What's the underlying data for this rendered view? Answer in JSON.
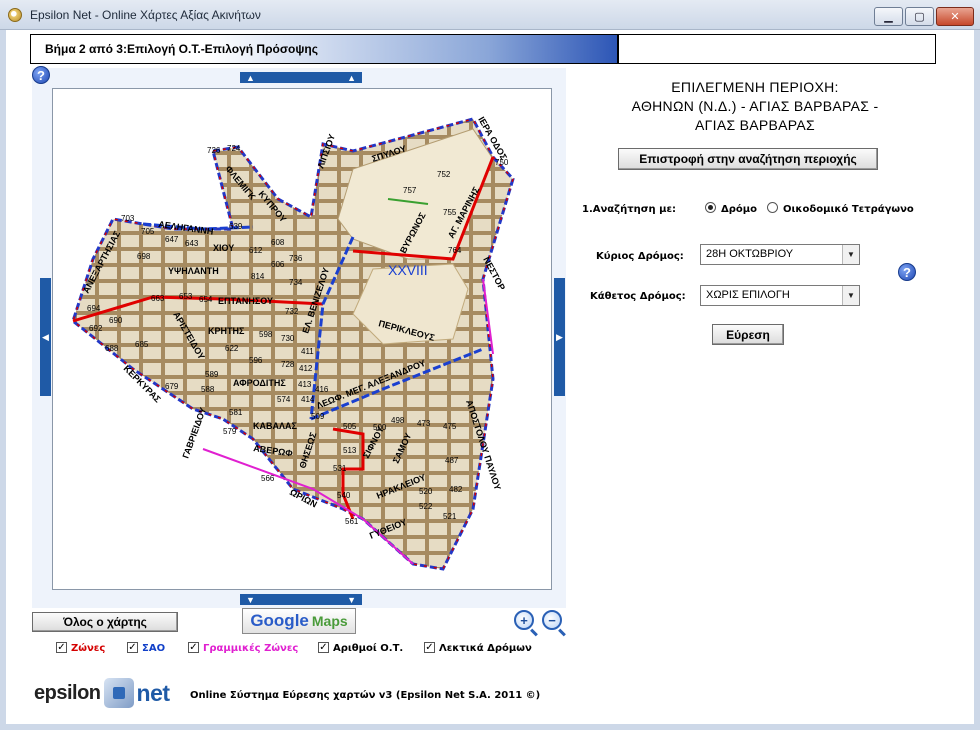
{
  "window": {
    "title": "Epsilon Net - Online Χάρτες Αξίας Ακινήτων",
    "minimize_glyph": "▁",
    "maximize_glyph": "▢",
    "close_glyph": "✕"
  },
  "header": {
    "step_label": "Βήμα 2 από 3:Επιλογή Ο.Τ.-Επιλογή Πρόσοψης"
  },
  "help_glyph": "?",
  "pan_glyph_up": "▲",
  "pan_glyph_down": "▼",
  "pan_glyph_left": "◀",
  "pan_glyph_right": "▶",
  "map": {
    "zone_label": "XXVIII",
    "streets": [
      "ΙΕΡΑ ΟΔΟΣ",
      "ΣΠΥΛΟΥ",
      "ΛΙΠΣΙΟΥ",
      "ΦΛΕΜΙΓΚ",
      "ΚΥΠΡΟΥ",
      "ΑΕΛΗΓΑΝΝΗ",
      "ΑΝΕΞΑΡΤΗΣΙΑΣ",
      "ΧΙΟΥ",
      "ΥΨΗΛΑΝΤΗ",
      "ΕΠΤΑΝΗΣΟΥ",
      "ΚΡΗΤΗΣ",
      "ΕΛ. ΒΕΝΙΖΕΛΟΥ",
      "ΒΥΡΩΝΟΣ",
      "ΑΓ. ΜΑΡΙΝΗΣ",
      "ΝΕΣΤΟΡ",
      "ΠΕΡΙΚΛΕΟΥΣ",
      "ΛΕΩΦ. ΜΕΓ. ΑΛΕΞΑΝΔΡΟΥ",
      "ΑΡΙΣΤΕΙΔΟΥ",
      "ΚΕΡΚΥΡΑΣ",
      "ΑΦΡΟΔΙΤΗΣ",
      "ΚΑΒΑΛΑΣ",
      "ΑΒΕΡΩΦ",
      "ΘΗΣΕΩΣ",
      "ΣΙΦΝΟΥ",
      "ΣΑΜΟΥ",
      "ΑΠΟΣΤΟΛΟΥ ΠΑΥΛΟΥ",
      "ΓΑΒΡΙΕΙΔΟΥ",
      "ΩΡΙΩΝ",
      "ΗΡΑΚΛΕΙΟΥ",
      "ΓΥΘΕΙΟΥ"
    ],
    "blocks": [
      "726",
      "724",
      "752",
      "750",
      "757",
      "755",
      "764",
      "703",
      "705",
      "639",
      "647",
      "643",
      "612",
      "608",
      "606",
      "736",
      "698",
      "814",
      "734",
      "663",
      "653",
      "654",
      "732",
      "694",
      "692",
      "690",
      "688",
      "685",
      "598",
      "730",
      "622",
      "596",
      "728",
      "411",
      "412",
      "413",
      "416",
      "414",
      "574",
      "589",
      "588",
      "679",
      "581",
      "579",
      "509",
      "505",
      "498",
      "500",
      "473",
      "475",
      "513",
      "531",
      "487",
      "566",
      "540",
      "520",
      "482",
      "522",
      "521",
      "561"
    ]
  },
  "panel": {
    "selected_area_lines": [
      "ΕΠΙΛΕΓΜΕΝΗ ΠΕΡΙΟΧΗ:",
      "ΑΘΗΝΩΝ (Ν.Δ.) - ΑΓΙΑΣ ΒΑΡΒΑΡΑΣ -",
      "ΑΓΙΑΣ ΒΑΡΒΑΡΑΣ"
    ],
    "back_button": "Επιστροφή στην αναζήτηση περιοχής",
    "search_by_label": "1.Αναζήτηση με:",
    "radio_street": "Δρόμο",
    "radio_block": "Οικοδομικό Τετράγωνο",
    "main_street_label": "Κύριος Δρόμος:",
    "main_street_value": "28Η ΟΚΤΩΒΡΙΟΥ",
    "cross_street_label": "Κάθετος Δρόμος:",
    "cross_street_value": "ΧΩΡΙΣ ΕΠΙΛΟΓΗ",
    "find_button": "Εύρεση"
  },
  "tools": {
    "whole_map_button": "Όλος ο χάρτης",
    "google_word": "Google",
    "maps_word": "Maps",
    "zoom_in_glyph": "+",
    "zoom_out_glyph": "−"
  },
  "layers": [
    {
      "label": "Ζώνες",
      "checked": true,
      "color": "#d40000"
    },
    {
      "label": "ΣΑΟ",
      "checked": true,
      "color": "#1140c8"
    },
    {
      "label": "Γραμμικές Ζώνες",
      "checked": true,
      "color": "#e020d0"
    },
    {
      "label": "Αριθμοί Ο.Τ.",
      "checked": true,
      "color": "#000000"
    },
    {
      "label": "Λεκτικά Δρόμων",
      "checked": true,
      "color": "#000000"
    }
  ],
  "check_glyph": "✓",
  "footer": {
    "logo_word1": "epsilon",
    "logo_word2": "net",
    "system_text": "Online Σύστημα Εύρεσης χαρτών v3 (Epsilon Net S.A. 2011 ©)"
  }
}
